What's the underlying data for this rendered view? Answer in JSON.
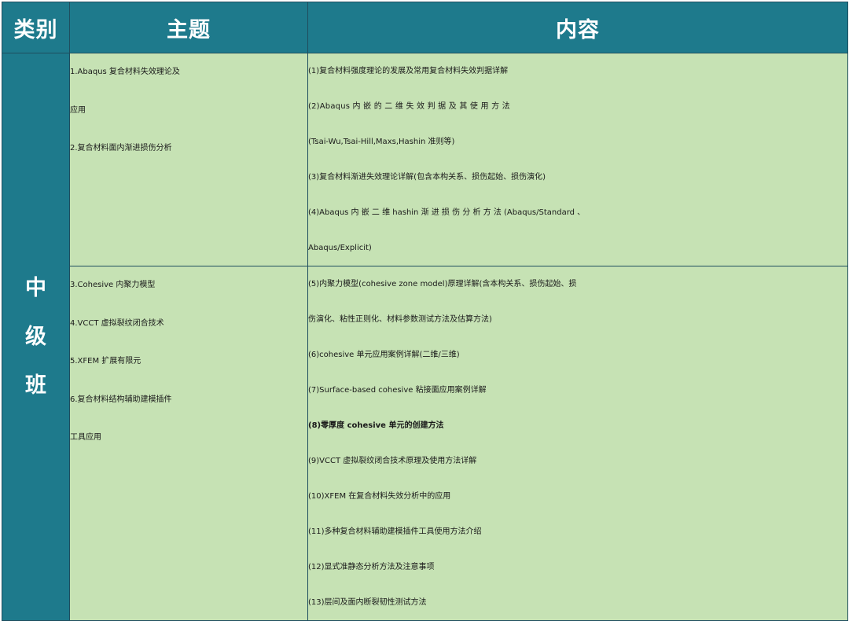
{
  "header": {
    "category": "类别",
    "topic": "主题",
    "content": "内容"
  },
  "category": "中级班",
  "sections": [
    {
      "topic_lines": [
        "1.Abaqus 复合材料失效理论及",
        "应用",
        "2.复合材料面内渐进损伤分析"
      ],
      "content_lines": [
        "(1)复合材料强度理论的发展及常用复合材料失效判据详解",
        "(2)Abaqus 内 嵌 的 二 维 失 效 判 据 及 其 使 用 方 法",
        "(Tsai-Wu,Tsai-Hill,Maxs,Hashin 准则等)",
        "(3)复合材料渐进失效理论详解(包含本构关系、损伤起始、损伤演化)",
        "(4)Abaqus 内 嵌 二 维 hashin 渐 进 损 伤 分 析 方 法 (Abaqus/Standard 、",
        "Abaqus/Explicit)"
      ]
    },
    {
      "topic_lines": [
        "3.Cohesive 内聚力模型",
        "4.VCCT 虚拟裂纹闭合技术",
        "5.XFEM 扩展有限元",
        "6.复合材料结构辅助建模插件",
        "工具应用"
      ],
      "content_lines": [
        "(5)内聚力模型(cohesive zone model)原理详解(含本构关系、损伤起始、损",
        "伤演化、粘性正则化、材料参数测试方法及估算方法)",
        "(6)cohesive 单元应用案例详解(二维/三维)",
        "(7)Surface-based cohesive 粘接面应用案例详解",
        "(8)零厚度 cohesive 单元的创建方法",
        "(9)VCCT 虚拟裂纹闭合技术原理及使用方法详解",
        "(10)XFEM 在复合材料失效分析中的应用",
        "(11)多种复合材料辅助建模插件工具使用方法介绍",
        "(12)显式准静态分析方法及注意事项",
        "(13)层间及面内断裂韧性测试方法"
      ]
    }
  ],
  "colors": {
    "header_bg": "#1e7a8c",
    "cell_bg": "#c6e2b4",
    "border": "#1f4e5f"
  }
}
